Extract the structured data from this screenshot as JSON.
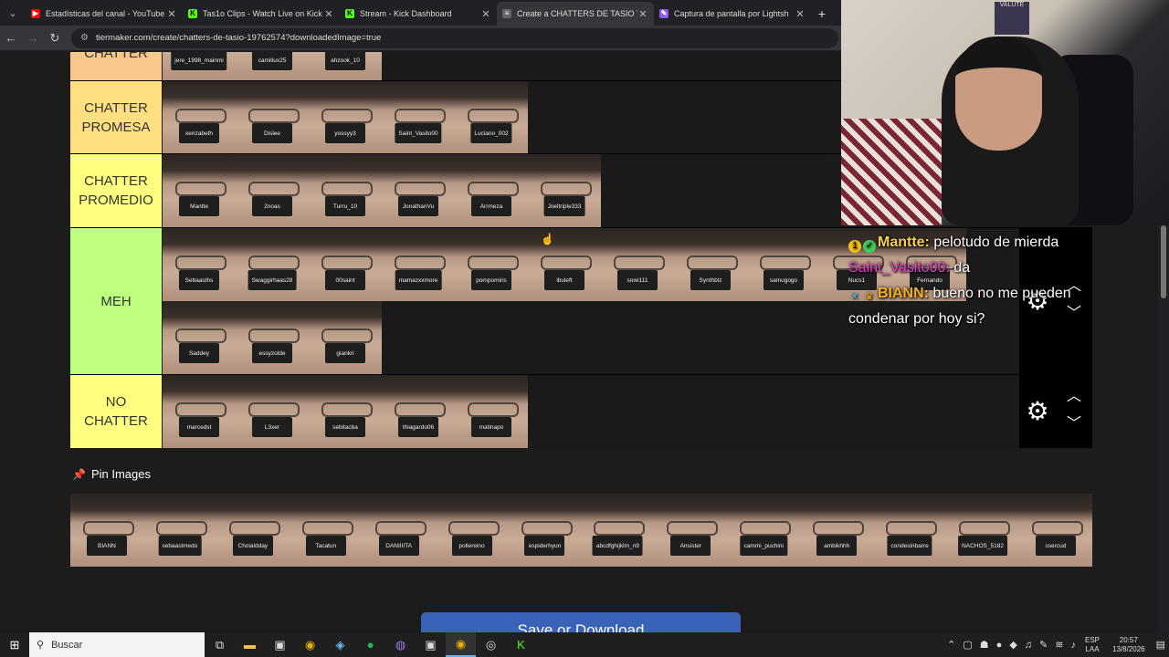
{
  "tabs": [
    {
      "title": "Estadísticas del canal - YouTube",
      "color": "#ff0000",
      "glyph": "▶"
    },
    {
      "title": "Tas1o Clips - Watch Live on Kick",
      "color": "#53fc18",
      "glyph": "K"
    },
    {
      "title": "Stream - Kick Dashboard",
      "color": "#53fc18",
      "glyph": "K"
    },
    {
      "title": "Create a CHATTERS DE TASIO T",
      "color": "#cccccc",
      "glyph": "≡"
    },
    {
      "title": "Captura de pantalla por Lightsh",
      "color": "#8a5cf6",
      "glyph": "✎"
    }
  ],
  "address": "tiermaker.com/create/chatters-de-tasio-19762574?downloadedImage=true",
  "tiers": [
    {
      "label": "CHATTER",
      "color": "#f8c88a",
      "items": [
        "jere_1998_mainmi",
        "camiliux25",
        "ahzook_10"
      ]
    },
    {
      "label": "CHATTER\nPROMESA",
      "color": "#ffdf7f",
      "items": [
        "xerizabeth",
        "Dislee",
        "yossyy3",
        "Saint_Vasito00",
        "Luciano_002"
      ]
    },
    {
      "label": "CHATTER\nPROMEDIO",
      "color": "#ffff7f",
      "items": [
        "Mantte",
        "2noas",
        "Turru_10",
        "JonathanVu",
        "Arrmeza",
        "Joeltriple333"
      ]
    },
    {
      "label": "MEH",
      "color": "#bfff7f",
      "items": [
        "Sebaasths",
        "Swaggirhaas28",
        "00saint",
        "mamazxxmore",
        "pompomiris",
        "ibuleft",
        "sowi111",
        "Synthblz",
        "samugogo",
        "Nucs1",
        "Fernando",
        "Saddey",
        "essyzolde",
        "giankri"
      ]
    },
    {
      "label": "NO\nCHATTER",
      "color": "#ffff7f",
      "items": [
        "marcedst",
        "L3xer",
        "sebitacba",
        "thiagardo06",
        "matinapo"
      ]
    }
  ],
  "pin": {
    "title": "Pin Images",
    "items": [
      "BIANN",
      "sebaaslmedo",
      "Choialdday",
      "Tacatun",
      "DANIIIITA",
      "pollereino",
      "espiderhyun",
      "abcdfghijklm_n9",
      "Ansister",
      "cammi_puchini",
      "ambikhhh",
      "condesinbarre",
      "NACHOS_5182",
      "ssercud"
    ]
  },
  "save_label": "Save or Download",
  "chat": [
    {
      "user": "Mantte:",
      "text": " pelotudo de mierda"
    },
    {
      "user": "Saint_Vasito00:",
      "text": " da"
    },
    {
      "user": "BIANN:",
      "text": " bueno no me pueden condenar por hoy si?"
    }
  ],
  "webcam": {
    "poster_text": "VALUTE"
  },
  "taskbar": {
    "search_placeholder": "Buscar",
    "lang_top": "ESP",
    "lang_bottom": "LAA",
    "time": "20:57",
    "date": "13/8/2026"
  }
}
